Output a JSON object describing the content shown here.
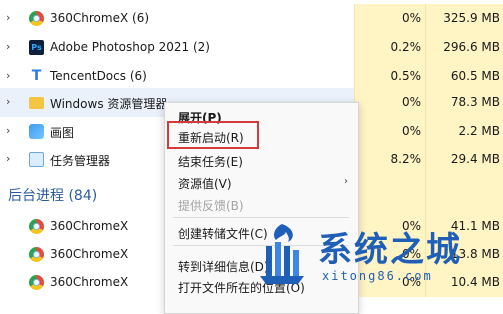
{
  "processes": [
    {
      "name": "360ChromeX (6)",
      "cpu": "0%",
      "mem": "325.9 MB",
      "icon": "chrome-icon"
    },
    {
      "name": "Adobe Photoshop 2021 (2)",
      "cpu": "0.2%",
      "mem": "296.6 MB",
      "icon": "photoshop-icon"
    },
    {
      "name": "TencentDocs (6)",
      "cpu": "0.5%",
      "mem": "60.5 MB",
      "icon": "tencent-docs-icon"
    },
    {
      "name": "Windows 资源管理器",
      "cpu": "0%",
      "mem": "78.3 MB",
      "icon": "folder-icon"
    },
    {
      "name": "画图",
      "cpu": "0%",
      "mem": "2.2 MB",
      "icon": "paint-icon"
    },
    {
      "name": "任务管理器",
      "cpu": "8.2%",
      "mem": "29.4 MB",
      "icon": "task-manager-icon"
    }
  ],
  "background_section": "后台进程 (84)",
  "background_processes": [
    {
      "name": "360ChromeX",
      "cpu": "0%",
      "mem": "41.1 MB"
    },
    {
      "name": "360ChromeX",
      "cpu": "0%",
      "mem": "13.8 MB"
    },
    {
      "name": "360ChromeX",
      "cpu": "0%",
      "mem": "10.4 MB"
    }
  ],
  "menu": {
    "expand": "展开(P)",
    "restart": "重新启动(R)",
    "end_task": "结束任务(E)",
    "resource_values": "资源值(V)",
    "feedback": "提供反馈(B)",
    "dump": "创建转储文件(C)",
    "details": "转到详细信息(D)",
    "open_location": "打开文件所在的位置(O)"
  },
  "watermark": {
    "title": "系统之城",
    "url": "xitong86.com"
  },
  "colors": {
    "highlight": "#d33a3a",
    "usage_bg": "#fff4c4",
    "section": "#2c5aa0"
  }
}
